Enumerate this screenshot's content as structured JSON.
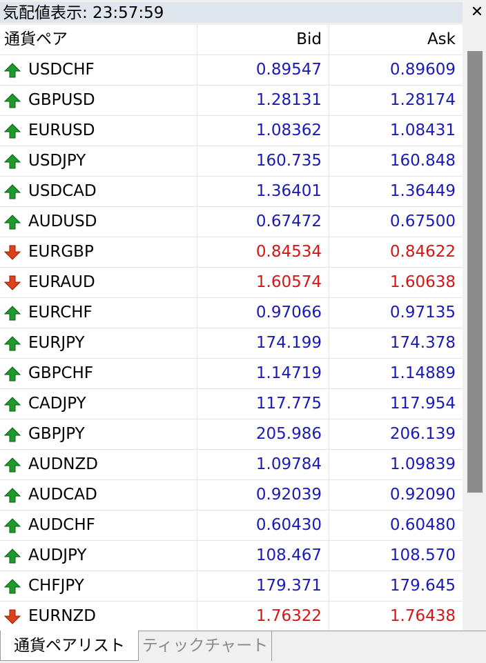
{
  "window": {
    "title": "気配値表示: 23:57:59",
    "close_glyph": "✕"
  },
  "table": {
    "headers": {
      "symbol": "通貨ペア",
      "bid": "Bid",
      "ask": "Ask"
    },
    "rows": [
      {
        "symbol": "USDCHF",
        "bid": "0.89547",
        "ask": "0.89609",
        "dir": "up"
      },
      {
        "symbol": "GBPUSD",
        "bid": "1.28131",
        "ask": "1.28174",
        "dir": "up"
      },
      {
        "symbol": "EURUSD",
        "bid": "1.08362",
        "ask": "1.08431",
        "dir": "up"
      },
      {
        "symbol": "USDJPY",
        "bid": "160.735",
        "ask": "160.848",
        "dir": "up"
      },
      {
        "symbol": "USDCAD",
        "bid": "1.36401",
        "ask": "1.36449",
        "dir": "up"
      },
      {
        "symbol": "AUDUSD",
        "bid": "0.67472",
        "ask": "0.67500",
        "dir": "up"
      },
      {
        "symbol": "EURGBP",
        "bid": "0.84534",
        "ask": "0.84622",
        "dir": "down"
      },
      {
        "symbol": "EURAUD",
        "bid": "1.60574",
        "ask": "1.60638",
        "dir": "down"
      },
      {
        "symbol": "EURCHF",
        "bid": "0.97066",
        "ask": "0.97135",
        "dir": "up"
      },
      {
        "symbol": "EURJPY",
        "bid": "174.199",
        "ask": "174.378",
        "dir": "up"
      },
      {
        "symbol": "GBPCHF",
        "bid": "1.14719",
        "ask": "1.14889",
        "dir": "up"
      },
      {
        "symbol": "CADJPY",
        "bid": "117.775",
        "ask": "117.954",
        "dir": "up"
      },
      {
        "symbol": "GBPJPY",
        "bid": "205.986",
        "ask": "206.139",
        "dir": "up"
      },
      {
        "symbol": "AUDNZD",
        "bid": "1.09784",
        "ask": "1.09839",
        "dir": "up"
      },
      {
        "symbol": "AUDCAD",
        "bid": "0.92039",
        "ask": "0.92090",
        "dir": "up"
      },
      {
        "symbol": "AUDCHF",
        "bid": "0.60430",
        "ask": "0.60480",
        "dir": "up"
      },
      {
        "symbol": "AUDJPY",
        "bid": "108.467",
        "ask": "108.570",
        "dir": "up"
      },
      {
        "symbol": "CHFJPY",
        "bid": "179.371",
        "ask": "179.645",
        "dir": "up"
      },
      {
        "symbol": "EURNZD",
        "bid": "1.76322",
        "ask": "1.76438",
        "dir": "down"
      }
    ]
  },
  "colors": {
    "up_text": "#1a1ab8",
    "down_text": "#d41616",
    "up_arrow": "#1e9a2a",
    "down_arrow": "#e0401a"
  },
  "icons": {
    "up": "arrow-up-icon",
    "down": "arrow-down-icon"
  },
  "tabs": [
    {
      "label": "通貨ペアリスト",
      "active": true
    },
    {
      "label": "ティックチャート",
      "active": false
    }
  ]
}
